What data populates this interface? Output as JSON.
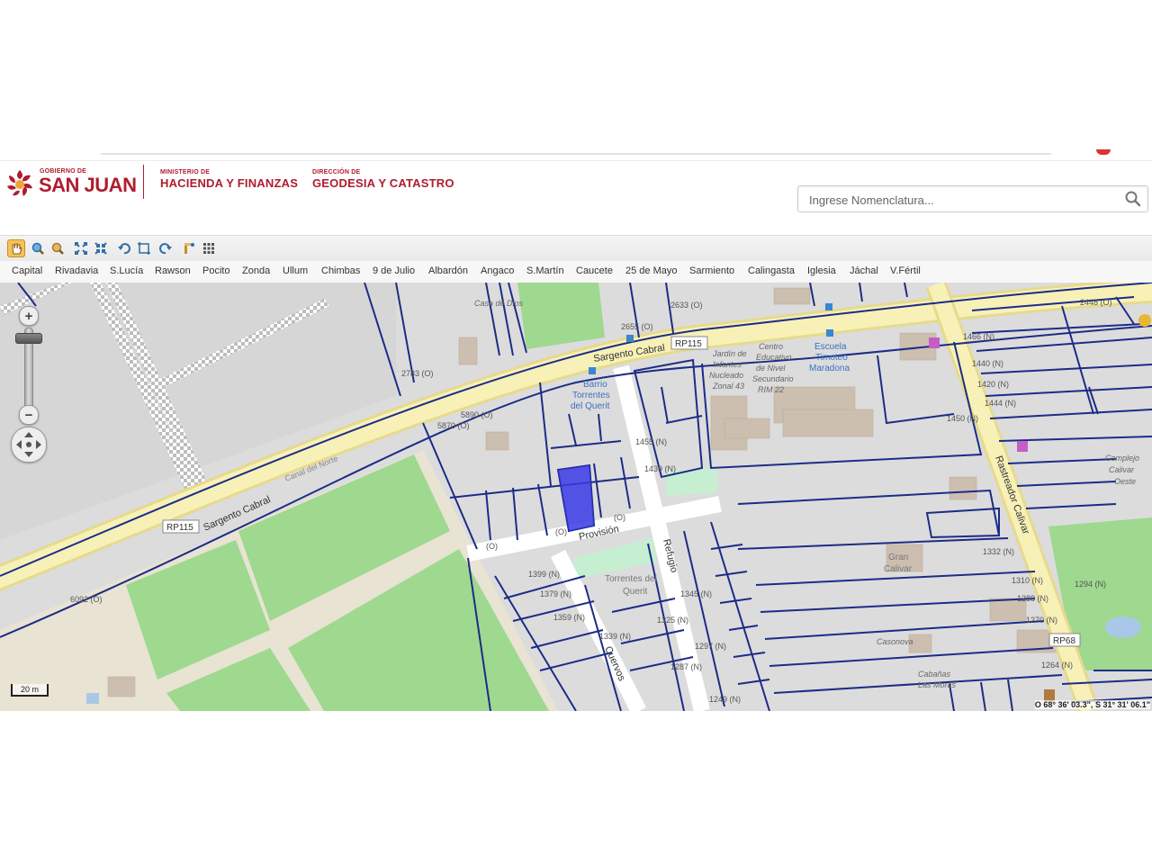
{
  "header": {
    "gov_small": "GOBIERNO DE",
    "gov_big": "SAN JUAN",
    "ministry_small": "MINISTERIO DE",
    "ministry_name": "HACIENDA Y FINANZAS",
    "direction_small": "DIRECCIÓN DE",
    "direction_name": "GEODESIA Y CATASTRO",
    "brand_color": "#b01c2e"
  },
  "search": {
    "placeholder": "Ingrese Nomenclatura..."
  },
  "toolbar": {
    "tools": [
      "pan-hand-icon",
      "zoom-in-tool-icon",
      "zoom-out-tool-icon",
      "zoom-extent-icon",
      "full-extent-icon",
      "undo-icon",
      "zoom-box-icon",
      "redo-icon",
      "measure-icon",
      "grid-icon"
    ]
  },
  "departments": [
    "Capital",
    "Rivadavia",
    "S.Lucía",
    "Rawson",
    "Pocito",
    "Zonda",
    "Ullum",
    "Chimbas",
    "9 de Julio",
    "Albardón",
    "Angaco",
    "S.Martín",
    "Caucete",
    "25 de Mayo",
    "Sarmiento",
    "Calingasta",
    "Iglesia",
    "Jáchal",
    "V.Fértil"
  ],
  "map": {
    "streets": {
      "sargento_cabral_1": "Sargento Cabral",
      "sargento_cabral_2": "Sargento Cabral",
      "route_1": "RP115",
      "route_2": "RP115",
      "route_3": "RP68",
      "provision": "Provisión",
      "refugio": "Refugio",
      "cuervos": "Cuervos",
      "rastreador": "Rastreador Calivar",
      "canal": "Canal del Norte"
    },
    "places": {
      "barrio_1": "Barrio",
      "barrio_2": "Torrentes",
      "barrio_3": "del Querit",
      "torrentes_1": "Torrentes del",
      "torrentes_2": "Querit",
      "escuela_1": "Escuela",
      "escuela_2": "Timoteo",
      "escuela_3": "Maradona",
      "jardin_1": "Jardín de",
      "jardin_2": "Infantes",
      "jardin_3": "Nucleado",
      "jardin_4": "Zonal 43",
      "centro_1": "Centro",
      "centro_2": "Educativo",
      "centro_3": "de Nivel",
      "centro_4": "Secundario",
      "centro_5": "RIM 22",
      "gran_1": "Gran",
      "gran_2": "Calivar",
      "complejo_1": "Complejo",
      "complejo_2": "Calivar",
      "complejo_3": "Oeste",
      "casonova": "Casonova",
      "cabanas_1": "Cabañas",
      "cabanas_2": "Las Moras",
      "casa": "Casa de Dios"
    },
    "parcels": {
      "p1": "2633 (O)",
      "p2": "2655 (O)",
      "p3": "2783 (O)",
      "p4": "5870 (O)",
      "p5": "5890 (O)",
      "p6": "6092 (O)",
      "p7": "1455 (N)",
      "p8": "1439 (N)",
      "p9": "1399 (N)",
      "p10": "1379 (N)",
      "p11": "1359 (N)",
      "p12": "1339 (N)",
      "p13": "1345 (N)",
      "p14": "1325 (N)",
      "p15": "1297 (N)",
      "p16": "1287 (N)",
      "p17": "1249 (N)",
      "p18": "1332 (N)",
      "p19": "1310 (N)",
      "p20": "1288 (N)",
      "p21": "1270 (N)",
      "p22": "1264 (N)",
      "p23": "1466 (N)",
      "p24": "1440 (N)",
      "p25": "1420 (N)",
      "p26": "1450 (N)",
      "p27": "1444 (N)",
      "p28": "2448 (O)",
      "p29": "1294 (N)",
      "p30": "(O)",
      "p31": "(O)",
      "p32": "(O)"
    },
    "scale_label": "20 m",
    "coordinates": "O 68° 36' 03.3\", S 31° 31' 06.1\""
  }
}
